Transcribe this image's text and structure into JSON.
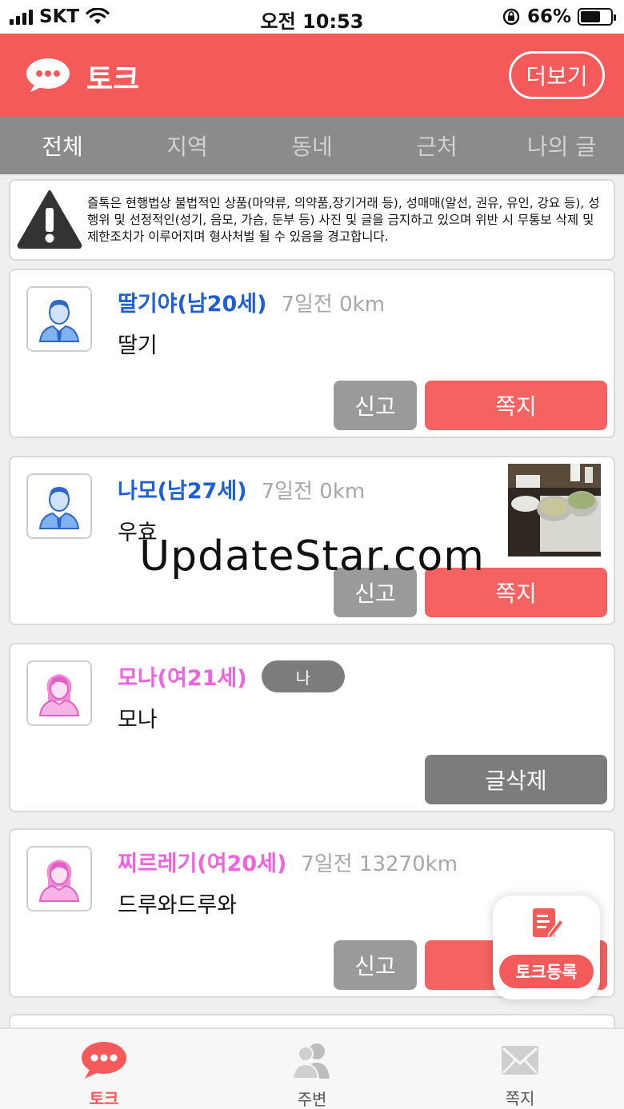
{
  "status_bar": {
    "carrier": "SKT",
    "time": "오전 10:53",
    "battery": "66%",
    "battery_level": 0.66
  },
  "header": {
    "title": "토크",
    "more_label": "더보기",
    "color": "#f55a5a"
  },
  "tabs": [
    {
      "label": "전체",
      "active": true
    },
    {
      "label": "지역",
      "active": false
    },
    {
      "label": "동네",
      "active": false
    },
    {
      "label": "근처",
      "active": false
    },
    {
      "label": "나의 글",
      "active": false
    }
  ],
  "notice": {
    "text": "즐톡은 현행법상 불법적인 상품(마약류, 의약품,장기거래 등), 성매매(알선, 권유, 유인, 강요 등), 성행위 및 선정적인(성기, 음모, 가슴, 둔부 등) 사진 및 글을 금지하고 있으며 위반 시 무통보 삭제 및 제한조치가 이루어지며 형사처벌 될 수 있음을 경고합니다."
  },
  "posts": [
    {
      "name": "딸기야(남20세)",
      "gender": "male",
      "meta": "7일전 0km",
      "message": "딸기",
      "report_label": "신고",
      "message_label": "쪽지"
    },
    {
      "name": "나모(남27세)",
      "gender": "male",
      "meta": "7일전 0km",
      "message": "우효",
      "report_label": "신고",
      "message_label": "쪽지"
    },
    {
      "name": "모나(여21세)",
      "gender": "female",
      "badge": "나",
      "message": "모나",
      "delete_label": "글삭제"
    },
    {
      "name": "찌르레기(여20세)",
      "gender": "female",
      "meta": "7일전 13270km",
      "message": "드루와드루와",
      "report_label": "신고"
    }
  ],
  "fab": {
    "label": "토크등록",
    "icon": "write-icon"
  },
  "watermark": "UpdateStar.com",
  "bottom_nav": [
    {
      "label": "토크",
      "icon": "chat-bubble-icon",
      "active": true
    },
    {
      "label": "주변",
      "icon": "people-icon",
      "active": false
    },
    {
      "label": "쪽지",
      "icon": "envelope-icon",
      "active": false
    }
  ]
}
